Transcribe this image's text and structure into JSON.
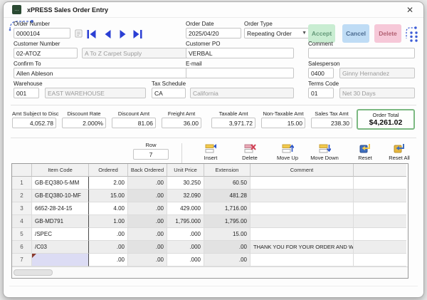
{
  "window": {
    "title": "xPRESS Sales Order Entry",
    "close_glyph": "✕"
  },
  "header": {
    "order_number": {
      "label": "Order Number",
      "value": "0000104"
    },
    "order_date": {
      "label": "Order Date",
      "value": "2025/04/20"
    },
    "order_type": {
      "label": "Order Type",
      "value": "Repeating Order"
    },
    "accept_label": "Accept",
    "cancel_label": "Cancel",
    "delete_label": "Delete"
  },
  "form": {
    "customer_number": {
      "label": "Customer Number",
      "value": "02-ATOZ",
      "name": "A To Z Carpet Supply"
    },
    "customer_po": {
      "label": "Customer PO",
      "value": "VERBAL"
    },
    "comment": {
      "label": "Comment",
      "value": ""
    },
    "confirm_to": {
      "label": "Confirm To",
      "value": "Allen Ableson"
    },
    "email": {
      "label": "E-mail",
      "value": ""
    },
    "salesperson": {
      "label": "Salesperson",
      "code": "0400",
      "name": "Ginny Hernandez"
    },
    "warehouse": {
      "label": "Warehouse",
      "code": "001",
      "name": "EAST WAREHOUSE"
    },
    "tax_schedule": {
      "label": "Tax Schedule",
      "code": "CA",
      "name": "California"
    },
    "terms_code": {
      "label": "Terms Code",
      "code": "01",
      "name": "Net 30 Days"
    }
  },
  "totals": {
    "fields": [
      {
        "label": "Amt Subject to Disc",
        "value": "4,052.78"
      },
      {
        "label": "Discount Rate",
        "value": "2.000%"
      },
      {
        "label": "Discount Amt",
        "value": "81.06"
      },
      {
        "label": "Freight Amt",
        "value": "36.00"
      },
      {
        "label": "Taxable Amt",
        "value": "3,971.72"
      },
      {
        "label": "Non-Taxable Amt",
        "value": "15.00"
      },
      {
        "label": "Sales Tax Amt",
        "value": "238.30"
      }
    ],
    "order_total": {
      "label": "Order Total",
      "value": "$4,261.02"
    }
  },
  "toolbar": {
    "row": {
      "label": "Row",
      "value": "7"
    },
    "buttons": [
      "Insert",
      "Delete",
      "Move Up",
      "Move Down",
      "Reset",
      "Reset All"
    ]
  },
  "grid": {
    "columns": {
      "item": "Item Code",
      "ordered": "Ordered",
      "back": "Back Ordered",
      "price": "Unit Price",
      "ext": "Extension",
      "comment": "Comment"
    },
    "rows": [
      {
        "num": "1",
        "item": "GB-EQ380-5-MM",
        "ordered": "2.00",
        "back": ".00",
        "price": "30.250",
        "ext": "60.50",
        "comment": ""
      },
      {
        "num": "2",
        "item": "GB-EQ380-10-MF",
        "ordered": "15.00",
        "back": ".00",
        "price": "32.090",
        "ext": "481.28",
        "comment": ""
      },
      {
        "num": "3",
        "item": "6652-28-24-15",
        "ordered": "4.00",
        "back": ".00",
        "price": "429.000",
        "ext": "1,716.00",
        "comment": ""
      },
      {
        "num": "4",
        "item": "GB-MD791",
        "ordered": "1.00",
        "back": ".00",
        "price": "1,795.000",
        "ext": "1,795.00",
        "comment": ""
      },
      {
        "num": "5",
        "item": "/SPEC",
        "ordered": ".00",
        "back": ".00",
        "price": ".000",
        "ext": "15.00",
        "comment": ""
      },
      {
        "num": "6",
        "item": "/C03",
        "ordered": ".00",
        "back": ".00",
        "price": ".000",
        "ext": ".00",
        "comment": "THANK YOU FOR YOUR ORDER AND W..."
      },
      {
        "num": "7",
        "item": "",
        "ordered": ".00",
        "back": ".00",
        "price": ".000",
        "ext": ".00",
        "comment": ""
      }
    ]
  },
  "colors": {
    "accept_bg": "#c9edd2",
    "cancel_bg": "#bfdcf5",
    "delete_bg": "#f6c8d8",
    "nav_blue": "#2b3fd4",
    "order_total_border": "#7cb982",
    "selected_cell_bg": "#dcdcf4",
    "title_icon": "#2b4a33"
  }
}
